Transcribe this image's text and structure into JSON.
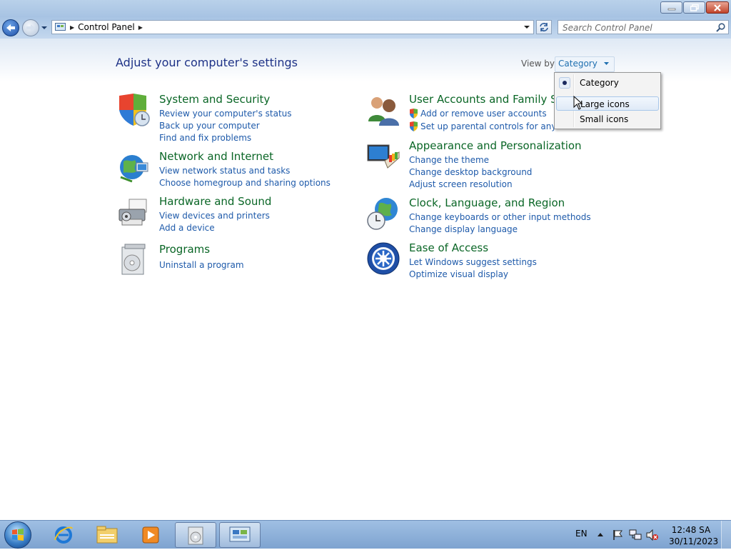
{
  "window": {
    "minimize_label": "minimize",
    "maximize_label": "restore",
    "close_label": "close"
  },
  "address": {
    "breadcrumb": "Control Panel",
    "search_placeholder": "Search Control Panel"
  },
  "content": {
    "page_title": "Adjust your computer's settings",
    "view_by_label": "View by:",
    "view_by_value": "Category"
  },
  "categories": [
    {
      "title": "System and Security",
      "icon": "shield-security-icon",
      "links": [
        "Review your computer's status",
        "Back up your computer",
        "Find and fix problems"
      ]
    },
    {
      "title": "Network and Internet",
      "icon": "network-globe-icon",
      "links": [
        "View network status and tasks",
        "Choose homegroup and sharing options"
      ]
    },
    {
      "title": "Hardware and Sound",
      "icon": "printer-speaker-icon",
      "links": [
        "View devices and printers",
        "Add a device"
      ]
    },
    {
      "title": "Programs",
      "icon": "programs-disc-icon",
      "links": [
        "Uninstall a program"
      ]
    },
    {
      "title": "User Accounts and Family Saf",
      "icon": "users-icon",
      "links": [
        "Add or remove user accounts",
        "Set up parental controls for any use"
      ]
    },
    {
      "title": "Appearance and Personalization",
      "icon": "monitor-palette-icon",
      "links": [
        "Change the theme",
        "Change desktop background",
        "Adjust screen resolution"
      ]
    },
    {
      "title": "Clock, Language, and Region",
      "icon": "clock-globe-icon",
      "links": [
        "Change keyboards or other input methods",
        "Change display language"
      ]
    },
    {
      "title": "Ease of Access",
      "icon": "ease-of-access-icon",
      "links": [
        "Let Windows suggest settings",
        "Optimize visual display"
      ]
    }
  ],
  "view_menu": {
    "items": [
      "Category",
      "Large icons",
      "Small icons"
    ],
    "selected": "Category",
    "highlighted": "Large icons"
  },
  "taskbar": {
    "pinned": [
      "internet-explorer-icon",
      "windows-explorer-icon",
      "media-player-icon",
      "programs-disc-icon",
      "control-panel-icon"
    ],
    "language": "EN",
    "time": "12:48 SA",
    "date": "30/11/2023"
  },
  "colors": {
    "category_title": "#0a6626",
    "link": "#1e5aaa",
    "page_title": "#1e3287"
  }
}
